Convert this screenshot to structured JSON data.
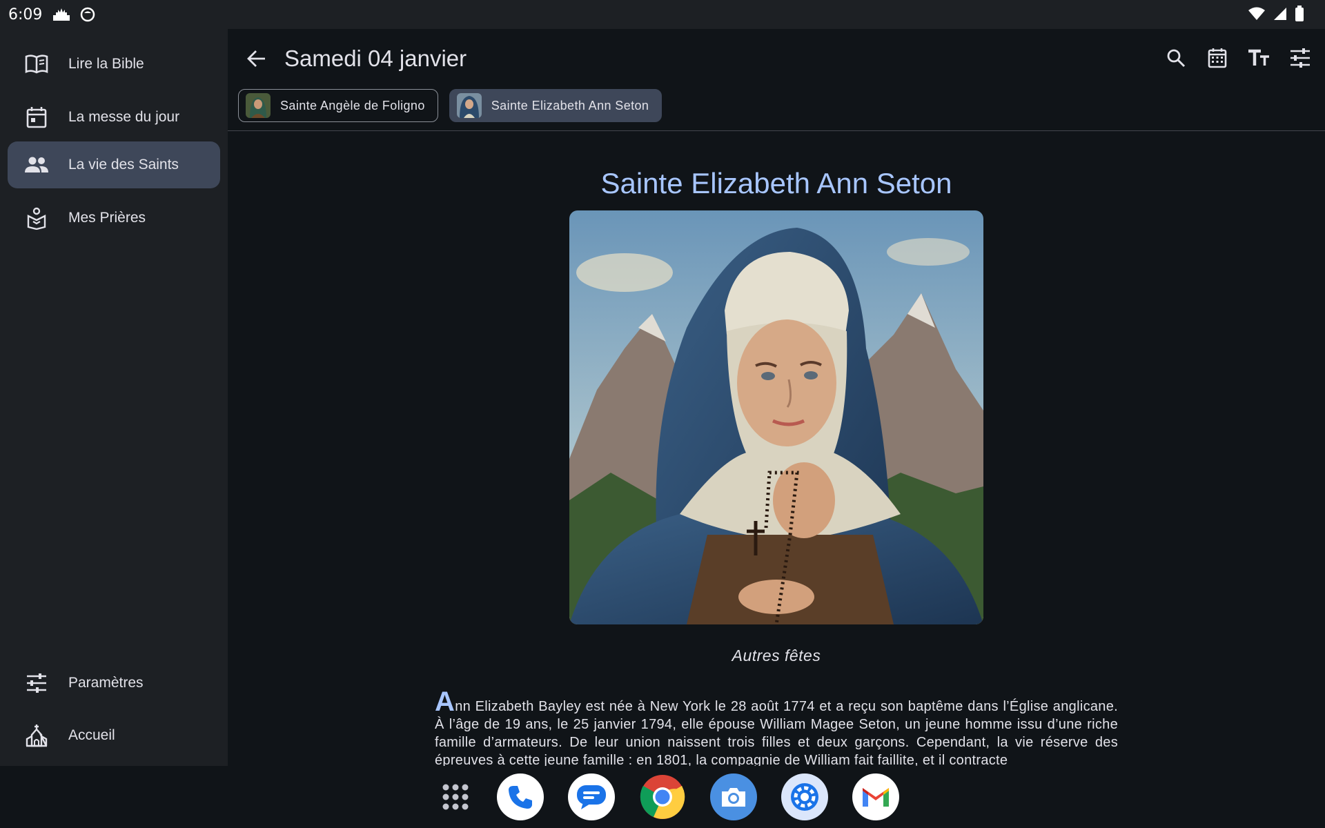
{
  "status_bar": {
    "time": "6:09"
  },
  "sidebar": {
    "items": [
      {
        "label": "Lire la Bible",
        "icon": "book-open-icon"
      },
      {
        "label": "La messe du jour",
        "icon": "calendar-day-icon"
      },
      {
        "label": "La vie des Saints",
        "icon": "people-icon",
        "active": true
      },
      {
        "label": "Mes Prières",
        "icon": "prayer-icon"
      }
    ],
    "bottom_items": [
      {
        "label": "Paramètres",
        "icon": "tune-icon"
      },
      {
        "label": "Accueil",
        "icon": "church-icon"
      }
    ]
  },
  "header": {
    "title": "Samedi 04 janvier"
  },
  "chips": [
    {
      "label": "Sainte Angèle de Foligno",
      "selected": false
    },
    {
      "label": "Sainte Elizabeth Ann Seton",
      "selected": true
    }
  ],
  "content": {
    "saint_name": "Sainte Elizabeth Ann Seton",
    "subtitle": "Autres fêtes",
    "dropcap": "A",
    "body": "nn Elizabeth Bayley est née à New York le 28 août 1774 et a reçu son baptême dans l’Église anglicane. À l’âge de 19 ans, le 25 janvier 1794, elle épouse William Magee Seton, un jeune homme issu d’une riche famille d’armateurs. De leur union naissent trois filles et deux garçons. Cependant, la vie réserve des épreuves à cette jeune famille : en 1801, la compagnie de William fait faillite, et il contracte"
  },
  "colors": {
    "accent": "#a8c6ff",
    "surface": "#1d2024",
    "background": "#101418",
    "active": "#3e4759"
  }
}
